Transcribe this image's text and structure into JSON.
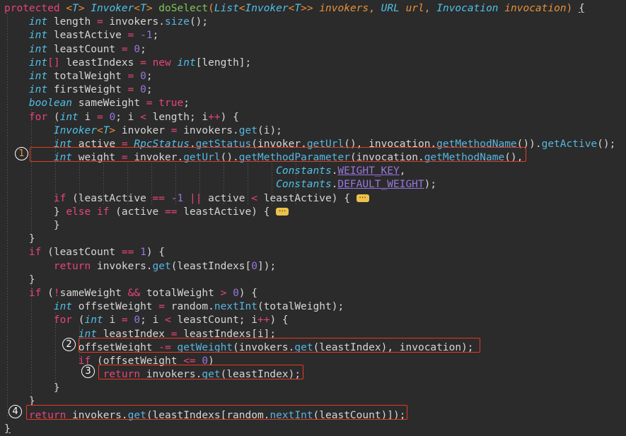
{
  "editor": {
    "language": "Java",
    "theme": "darcula",
    "background_color": "#2b2b2b",
    "annotation_color": "#e83a20",
    "code_lines": [
      "protected <T> Invoker<T> doSelect(List<Invoker<T>> invokers, URL url, Invocation invocation) {",
      "    int length = invokers.size();",
      "    int leastActive = -1;",
      "    int leastCount = 0;",
      "    int[] leastIndexs = new int[length];",
      "    int totalWeight = 0;",
      "    int firstWeight = 0;",
      "    boolean sameWeight = true;",
      "    for (int i = 0; i < length; i++) {",
      "        Invoker<T> invoker = invokers.get(i);",
      "        int active = RpcStatus.getStatus(invoker.getUrl(), invocation.getMethodName()).getActive();",
      "        int weight = invoker.getUrl().getMethodParameter(invocation.getMethodName(),",
      "                                            Constants.WEIGHT_KEY,",
      "                                            Constants.DEFAULT_WEIGHT);",
      "        if (leastActive == -1 || active < leastActive) { ...",
      "        } else if (active == leastActive) { ...",
      "        }",
      "    }",
      "    if (leastCount == 1) {",
      "        return invokers.get(leastIndexs[0]);",
      "    }",
      "    if (!sameWeight && totalWeight > 0) {",
      "        int offsetWeight = random.nextInt(totalWeight);",
      "        for (int i = 0; i < leastCount; i++) {",
      "            int leastIndex = leastIndexs[i];",
      "            offsetWeight -= getWeight(invokers.get(leastIndex), invocation);",
      "            if (offsetWeight <= 0)",
      "                return invokers.get(leastIndex);",
      "        }",
      "    }",
      "    return invokers.get(leastIndexs[random.nextInt(leastCount)]);",
      "}"
    ],
    "folded_regions": [
      {
        "line": 14,
        "label": "..."
      },
      {
        "line": 15,
        "label": "..."
      }
    ],
    "annotations": [
      {
        "marker": "①",
        "number": "1",
        "code": "int weight = invoker.getUrl().getMethodParameter(invocation.getMethodName(),"
      },
      {
        "marker": "②",
        "number": "2",
        "code": "offsetWeight -= getWeight(invokers.get(leastIndex), invocation);"
      },
      {
        "marker": "③",
        "number": "3",
        "code": "return invokers.get(leastIndex);"
      },
      {
        "marker": "④",
        "number": "4",
        "code": "return invokers.get(leastIndexs[random.nextInt(leastCount)]);"
      }
    ]
  },
  "tokens": {
    "l0": {
      "protected": "protected",
      "sp1": " ",
      "lt1": "<",
      "T1": "T",
      "gt1": "> ",
      "Invoker": "Invoker",
      "lt2": "<",
      "T2": "T",
      "gt2": "> ",
      "doSelect": "doSelect",
      "p1": "(",
      "List": "List",
      "lt3": "<",
      "Invoker2": "Invoker",
      "lt4": "<",
      "T3": "T",
      "gt3": ">>",
      "sp2": " ",
      "invokers": "invokers",
      "c1": ", ",
      "URL": "URL",
      "sp3": " ",
      "url": "url",
      "c2": ", ",
      "Invocation": "Invocation",
      "sp4": " ",
      "invocation": "invocation",
      "p2": ") ",
      "brace": "{"
    },
    "l1": {
      "ind": "    ",
      "int": "int",
      "name": " length ",
      "eq": "=",
      "rest": " invokers.",
      "meth": "size",
      "tail": "();"
    },
    "l2": {
      "ind": "    ",
      "int": "int",
      "name": " leastActive ",
      "eq": "=",
      "sp": " ",
      "num": "-1",
      "semi": ";"
    },
    "l3": {
      "ind": "    ",
      "int": "int",
      "name": " leastCount ",
      "eq": "=",
      "sp": " ",
      "num": "0",
      "semi": ";"
    },
    "l4": {
      "ind": "    ",
      "int": "int",
      "brk": "[] ",
      "name": "leastIndexs ",
      "eq": "=",
      "sp": " ",
      "new": "new",
      "sp2": " ",
      "int2": "int",
      "tail": "[length];"
    },
    "l5": {
      "ind": "    ",
      "int": "int",
      "name": " totalWeight ",
      "eq": "=",
      "sp": " ",
      "num": "0",
      "semi": ";"
    },
    "l6": {
      "ind": "    ",
      "int": "int",
      "name": " firstWeight ",
      "eq": "=",
      "sp": " ",
      "num": "0",
      "semi": ";"
    },
    "l7": {
      "ind": "    ",
      "bool": "boolean",
      "name": " sameWeight ",
      "eq": "=",
      "sp": " ",
      "true": "true",
      "semi": ";"
    },
    "l8": {
      "ind": "    ",
      "for": "for",
      "p": " (",
      "int": "int",
      "i": " i ",
      "eq": "=",
      "sp": " ",
      "zero": "0",
      "semi": "; i ",
      "lt": "<",
      "len": " length; i",
      "pp": "++",
      "tail": ") {"
    },
    "l9": {
      "ind": "        ",
      "Invoker": "Invoker",
      "lt": "<",
      "T": "T",
      "gt": "> ",
      "name": "invoker ",
      "eq": "=",
      "rest": " invokers.",
      "meth": "get",
      "tail": "(i);"
    },
    "l10": {
      "ind": "        ",
      "int": "int",
      "name": " active ",
      "eq": "=",
      "sp": " ",
      "Rpc": "RpcStatus",
      "dot": ".",
      "m1": "getStatus",
      "p1": "(invoker.",
      "m2": "getUrl",
      "p2": "(), invocation.",
      "m3": "getMethodName",
      "p3": "()).",
      "m4": "getActive",
      "tail": "();"
    },
    "l11": {
      "ind": "        ",
      "int": "int",
      "name": " weight ",
      "eq": "=",
      "p1": " invoker.",
      "m1": "getUrl",
      "p2": "().",
      "m2": "getMethodParameter",
      "p3": "(invocation.",
      "m3": "getMethodName",
      "tail": "(),"
    },
    "l12": {
      "ind": "                                            ",
      "Constants": "Constants",
      "dot": ".",
      "field": "WEIGHT_KEY",
      "tail": ","
    },
    "l13": {
      "ind": "                                            ",
      "Constants": "Constants",
      "dot": ".",
      "field": "DEFAULT_WEIGHT",
      "tail": ");"
    },
    "l14": {
      "ind": "        ",
      "if": "if",
      "p": " (leastActive ",
      "eqeq": "==",
      "sp": " ",
      "num": "-1",
      "sp2": " ",
      "or": "||",
      "mid": " active ",
      "lt": "<",
      "tail": " leastActive) { "
    },
    "l15": {
      "ind": "        ",
      "cb": "} ",
      "else": "else",
      "sp": " ",
      "if": "if",
      "tail": " (active ",
      "eqeq": "==",
      "rest": " leastActive) { "
    },
    "l16": {
      "ind": "        ",
      "cb": "}"
    },
    "l17": {
      "ind": "    ",
      "cb": "}"
    },
    "l18": {
      "ind": "    ",
      "if": "if",
      "p": " (leastCount ",
      "eqeq": "==",
      "sp": " ",
      "num": "1",
      "tail": ") {"
    },
    "l19": {
      "ind": "        ",
      "ret": "return",
      "sp": " invokers.",
      "meth": "get",
      "p": "(leastIndexs[",
      "num": "0",
      "tail": "]);"
    },
    "l20": {
      "ind": "    ",
      "cb": "}"
    },
    "l21": {
      "ind": "    ",
      "if": "if",
      "p": " (",
      "bang": "!",
      "name": "sameWeight ",
      "and": "&&",
      "mid": " totalWeight ",
      "gt": ">",
      "sp": " ",
      "num": "0",
      "tail": ") {"
    },
    "l22": {
      "ind": "        ",
      "int": "int",
      "name": " offsetWeight ",
      "eq": "=",
      "p": " random.",
      "meth": "nextInt",
      "tail": "(totalWeight);"
    },
    "l23": {
      "ind": "        ",
      "for": "for",
      "p": " (",
      "int": "int",
      "i": " i ",
      "eq": "=",
      "sp": " ",
      "zero": "0",
      "semi": "; i ",
      "lt": "<",
      "len": " leastCount; i",
      "pp": "++",
      "tail": ") {"
    },
    "l24": {
      "ind": "            ",
      "int": "int",
      "name": " leastIndex ",
      "eq": "=",
      "tail": " leastIndexs[i];"
    },
    "l25": {
      "ind": "            ",
      "name": "offsetWeight ",
      "op": "-=",
      "sp": " ",
      "meth": "getWeight",
      "p": "(invokers.",
      "meth2": "get",
      "tail": "(leastIndex), invocation);"
    },
    "l26": {
      "ind": "            ",
      "if": "if",
      "p": " (offsetWeight ",
      "le": "<=",
      "sp": " ",
      "num": "0",
      "tail": ")"
    },
    "l27": {
      "ind": "                ",
      "ret": "return",
      "sp": " invokers.",
      "meth": "get",
      "tail": "(leastIndex);"
    },
    "l28": {
      "ind": "        ",
      "cb": "}"
    },
    "l29": {
      "ind": "    ",
      "cb": "}"
    },
    "l30": {
      "ind": "    ",
      "ret": "return",
      "sp": " invokers.",
      "meth": "get",
      "p": "(leastIndexs[random.",
      "meth2": "nextInt",
      "tail": "(leastCount)]);"
    },
    "l31": {
      "cb": "}"
    }
  },
  "markers": {
    "m1": "①",
    "m2": "②",
    "m3": "③",
    "m4": "④"
  },
  "fold_label": "···"
}
